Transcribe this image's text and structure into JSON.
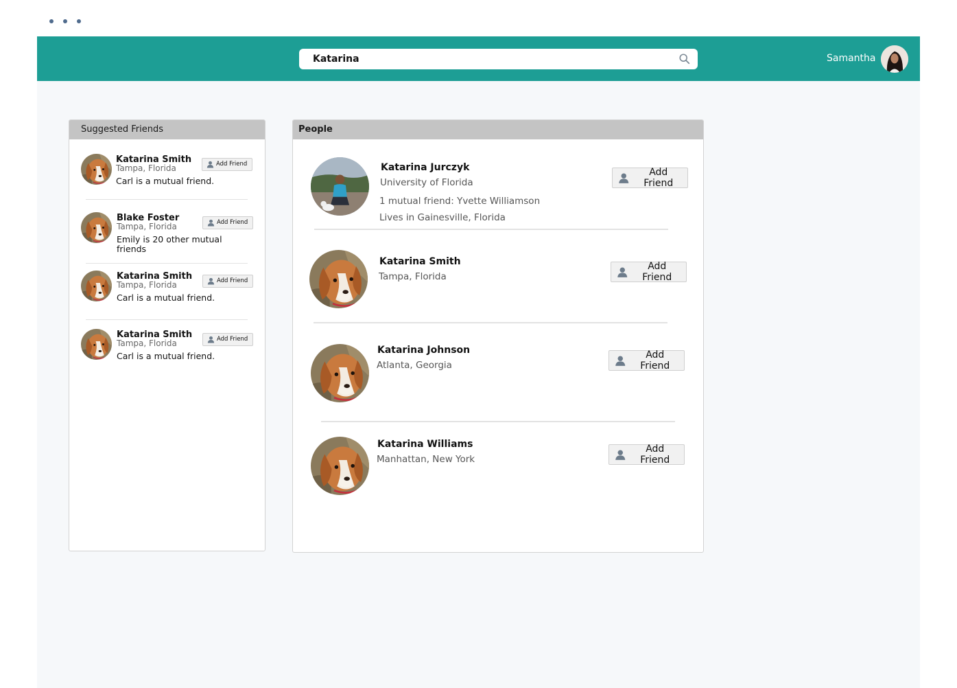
{
  "header": {
    "search_value": "Katarina",
    "user_name": "Samantha"
  },
  "suggested": {
    "title": "Suggested Friends",
    "items": [
      {
        "name": "Katarina Smith",
        "location": "Tampa, Florida",
        "mutual": "Carl is a mutual friend.",
        "button": "Add Friend"
      },
      {
        "name": "Blake Foster",
        "location": "Tampa, Florida",
        "mutual": "Emily is 20 other mutual friends",
        "button": "Add Friend"
      },
      {
        "name": "Katarina Smith",
        "location": "Tampa, Florida",
        "mutual": "Carl is a mutual friend.",
        "button": "Add Friend"
      },
      {
        "name": "Katarina Smith",
        "location": "Tampa, Florida",
        "mutual": "Carl is a mutual friend.",
        "button": "Add Friend"
      }
    ]
  },
  "people": {
    "title": "People",
    "items": [
      {
        "name": "Katarina Jurczyk",
        "school": "University of Florida",
        "mutual": "1 mutual friend: Yvette Williamson",
        "lives": "Lives in Gainesville, Florida",
        "button": "Add Friend"
      },
      {
        "name": "Katarina Smith",
        "location": "Tampa, Florida",
        "button": "Add Friend"
      },
      {
        "name": "Katarina Johnson",
        "location": "Atlanta, Georgia",
        "button": "Add Friend"
      },
      {
        "name": "Katarina Williams",
        "location": "Manhattan, New York",
        "button": "Add Friend"
      }
    ]
  },
  "colors": {
    "topbar": "#1d9e95",
    "panel_header": "#c4c4c4",
    "background": "#f6f8fa"
  }
}
